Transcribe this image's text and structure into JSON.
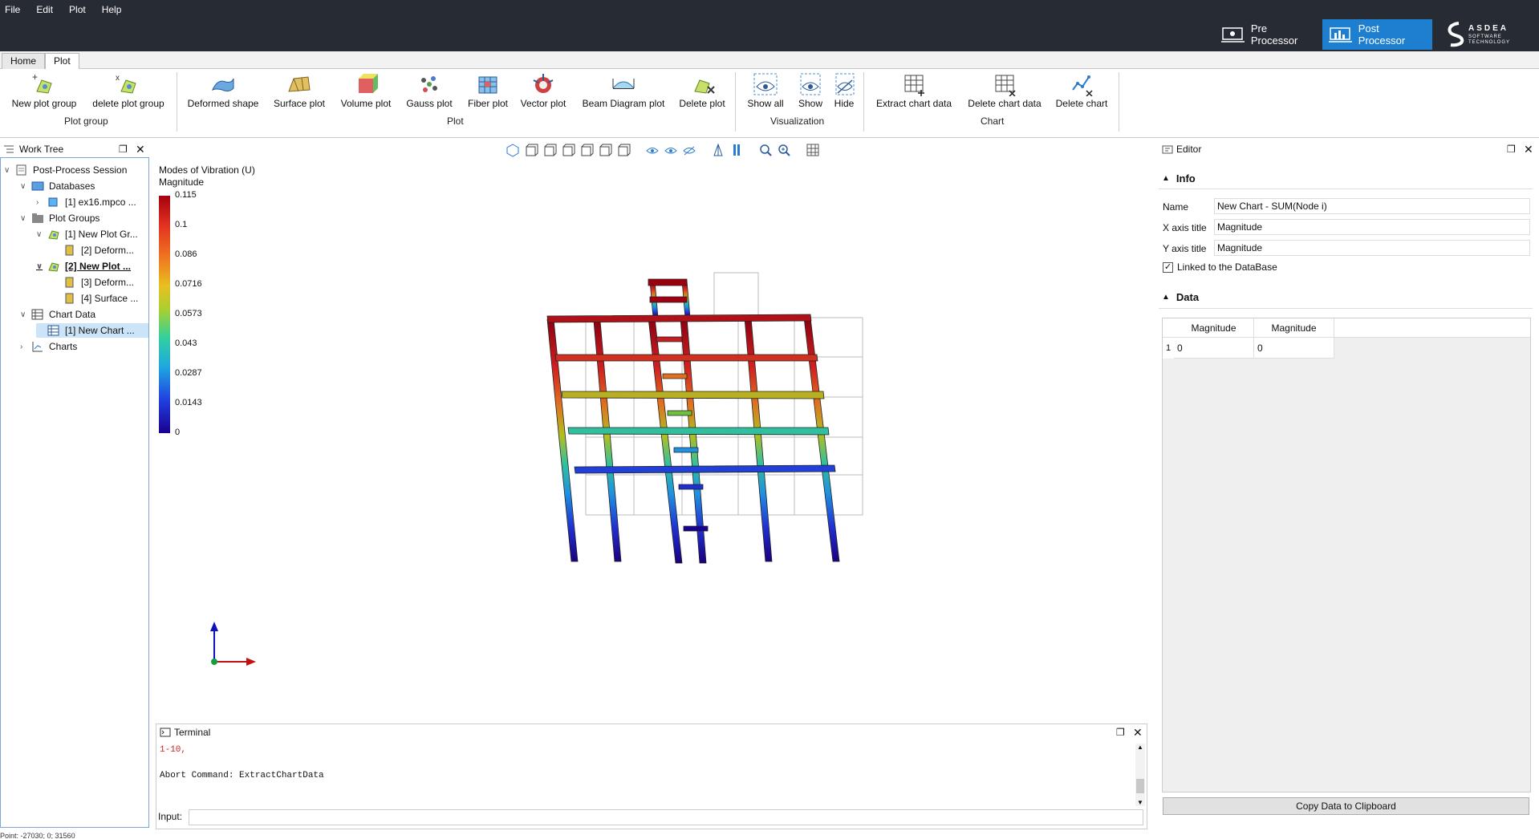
{
  "menu": [
    "File",
    "Edit",
    "Plot",
    "Help"
  ],
  "processors": {
    "pre": "Pre Processor",
    "post": "Post Processor",
    "logo_main": "ASDEA",
    "logo_sub": "SOFTWARE TECHNOLOGY"
  },
  "tabs": [
    "Home",
    "Plot"
  ],
  "ribbon": {
    "plot_group": {
      "label": "Plot group",
      "buttons": [
        "New plot group",
        "delete plot group"
      ]
    },
    "plot": {
      "label": "Plot",
      "buttons": [
        "Deformed shape",
        "Surface plot",
        "Volume plot",
        "Gauss plot",
        "Fiber plot",
        "Vector plot",
        "Beam Diagram plot",
        "Delete plot"
      ]
    },
    "visualization": {
      "label": "Visualization",
      "buttons": [
        "Show all",
        "Show",
        "Hide"
      ]
    },
    "chart": {
      "label": "Chart",
      "buttons": [
        "Extract chart data",
        "Delete chart data",
        "Delete chart"
      ]
    }
  },
  "work_tree": {
    "title": "Work Tree",
    "items": [
      "Post-Process Session",
      "Databases",
      "[1] ex16.mpco ...",
      "Plot Groups",
      "[1] New Plot Gr...",
      "[2] Deform...",
      "[2] New Plot ...",
      "[3] Deform...",
      "[4] Surface ...",
      "Chart Data",
      "[1] New Chart ...",
      "Charts"
    ]
  },
  "legend": {
    "title": "Modes of Vibration (U)",
    "subtitle": "Magnitude",
    "ticks": [
      "0.115",
      "0.1",
      "0.086",
      "0.0716",
      "0.0573",
      "0.043",
      "0.0287",
      "0.0143",
      "0"
    ]
  },
  "terminal": {
    "title": "Terminal",
    "lines": [
      "1-10,",
      "",
      "Abort Command: ExtractChartData"
    ],
    "input_label": "Input:"
  },
  "editor": {
    "title": "Editor",
    "info_header": "Info",
    "name_label": "Name",
    "name_value": "New Chart - SUM(Node i)",
    "x_label": "X axis title",
    "x_value": "Magnitude",
    "y_label": "Y axis title",
    "y_value": "Magnitude",
    "linked_label": "Linked to the DataBase",
    "linked_checked": true,
    "data_header": "Data",
    "table": {
      "headers": [
        "Magnitude",
        "Magnitude"
      ],
      "row_num": "1",
      "row": [
        "0",
        "0"
      ]
    },
    "copy_button": "Copy Data to Clipboard"
  },
  "status": "Point: -27030; 0; 31560",
  "colors": {
    "topbar": "#272b33",
    "post_active": "#1e7fd0",
    "accent": "#1e7fd0"
  }
}
